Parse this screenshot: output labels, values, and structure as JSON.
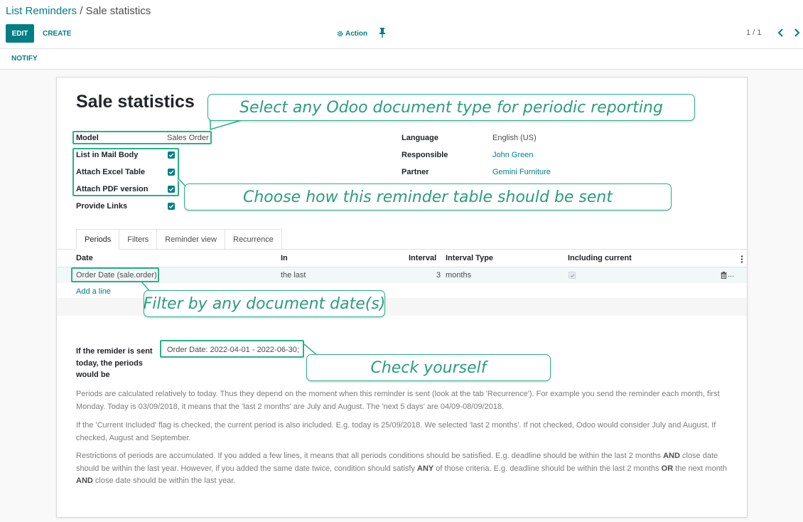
{
  "breadcrumb": {
    "parent": "List Reminders",
    "separator": " / ",
    "current": "Sale statistics"
  },
  "toolbar": {
    "edit_label": "EDIT",
    "create_label": "CREATE",
    "action_label": "Action",
    "action_icon": "gear-icon",
    "pin_icon": "pin-icon"
  },
  "pager": {
    "value": "1 / 1"
  },
  "status_bar": {
    "notify_label": "NOTIFY"
  },
  "form": {
    "title": "Sale statistics",
    "left": {
      "model_label": "Model",
      "model_value": "Sales Order",
      "list_in_mail_body_label": "List in Mail Body",
      "list_in_mail_body": true,
      "attach_excel_label": "Attach Excel Table",
      "attach_excel": true,
      "attach_pdf_label": "Attach PDF version",
      "attach_pdf": true,
      "provide_links_label": "Provide Links",
      "provide_links": true
    },
    "right": {
      "language_label": "Language",
      "language_value": "English (US)",
      "responsible_label": "Responsible",
      "responsible_value": "John Green",
      "partner_label": "Partner",
      "partner_value": "Gemini Furniture"
    }
  },
  "tabs": [
    {
      "label": "Periods",
      "active": true
    },
    {
      "label": "Filters",
      "active": false
    },
    {
      "label": "Reminder view",
      "active": false
    },
    {
      "label": "Recurrence",
      "active": false
    }
  ],
  "periods_table": {
    "columns": [
      "Date",
      "In",
      "Interval",
      "Interval Type",
      "Including current"
    ],
    "rows": [
      {
        "date": "Order Date (sale.order)",
        "in": "the last",
        "interval": "3",
        "interval_type": "months",
        "including_current": true,
        "more": "..."
      }
    ],
    "add_line_label": "Add a line"
  },
  "periods_preview": {
    "label": "If the remider is sent today, the periods would be",
    "value": "Order Date: 2022-04-01 - 2022-06-30;"
  },
  "help": {
    "p1": "Periods are calculated relatively to today. Thus they depend on the moment when this reminder is sent (look at the tab 'Recurrence'). For example you send the reminder each month, first Monday. Today is 03/09/2018, it means that the 'last 2 months' are July and August. The 'next 5 days' are 04/09-08/09/2018.",
    "p2": "If the 'Current Included' flag is checked, the current period is also included. E.g. today is 25/09/2018. We selected 'last 2 months'. If not checked, Odoo would consider July and August. If checked, August and September.",
    "p3_a": "Restrictions of periods are accumulated. If you added a few lines, it means that all periods conditions should be satisfied. E.g. deadline should be within the last 2 months ",
    "p3_and1": "AND",
    "p3_b": " close date should be within the last year. However, if you added the same date twice, condition should satisfy ",
    "p3_any": "ANY",
    "p3_c": " of those criteria. E.g. deadline should be within the last 2 months ",
    "p3_or": "OR",
    "p3_d": " the next month ",
    "p3_and2": "AND",
    "p3_e": " close date should be within the last year."
  },
  "callouts": {
    "model": "Select any Odoo document type for periodic reporting",
    "send": "Choose how this reminder table should be sent",
    "date": "Filter by any document date(s)",
    "check": "Check yourself"
  },
  "colors": {
    "accent": "#017e84",
    "callout": "#2ab089"
  }
}
